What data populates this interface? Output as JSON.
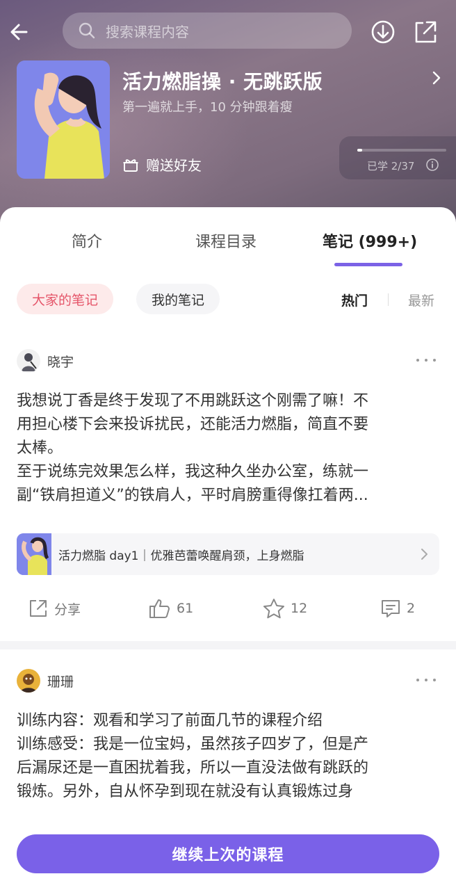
{
  "header": {
    "search_placeholder": "搜索课程内容",
    "course_title": "活力燃脂操 · 无跳跃版",
    "course_subtitle": "第一遍就上手，10 分钟跟着瘦",
    "gift_label": "赠送好友",
    "progress_text": "已学 2/37",
    "progress_fraction": 0.054
  },
  "tabs": [
    {
      "label": "简介"
    },
    {
      "label": "课程目录"
    },
    {
      "label": "笔记 (999+)",
      "active": true
    }
  ],
  "filters": {
    "everyone": "大家的笔记",
    "mine": "我的笔记",
    "hot": "热门",
    "newest": "最新"
  },
  "notes": [
    {
      "author": "晓宇",
      "lines": [
        "我想说丁香是终于发现了不用跳跃这个刚需了嘛！不",
        "用担心楼下会来投诉扰民，还能活力燃脂，简直不要",
        "太棒。",
        "至于说练完效果怎么样，我这种久坐办公室，练就一",
        "副“铁肩担道义”的铁肩人，平时肩膀重得像扛着两..."
      ],
      "lesson": "活力燃脂 day1｜优雅芭蕾唤醒肩颈，上身燃脂",
      "share_label": "分享",
      "likes": "61",
      "favorites": "12",
      "comments": "2"
    },
    {
      "author": "珊珊",
      "lines": [
        "训练内容：观看和学习了前面几节的课程介绍",
        "训练感受：我是一位宝妈，虽然孩子四岁了，但是产",
        "后漏尿还是一直困扰着我，所以一直没法做有跳跃的",
        "锻炼。另外，自从怀孕到现在就没有认真锻炼过身"
      ]
    }
  ],
  "cta": {
    "label": "继续上次的课程"
  },
  "colors": {
    "accent": "#7a61e8",
    "chip_active_text": "#e5566a"
  }
}
